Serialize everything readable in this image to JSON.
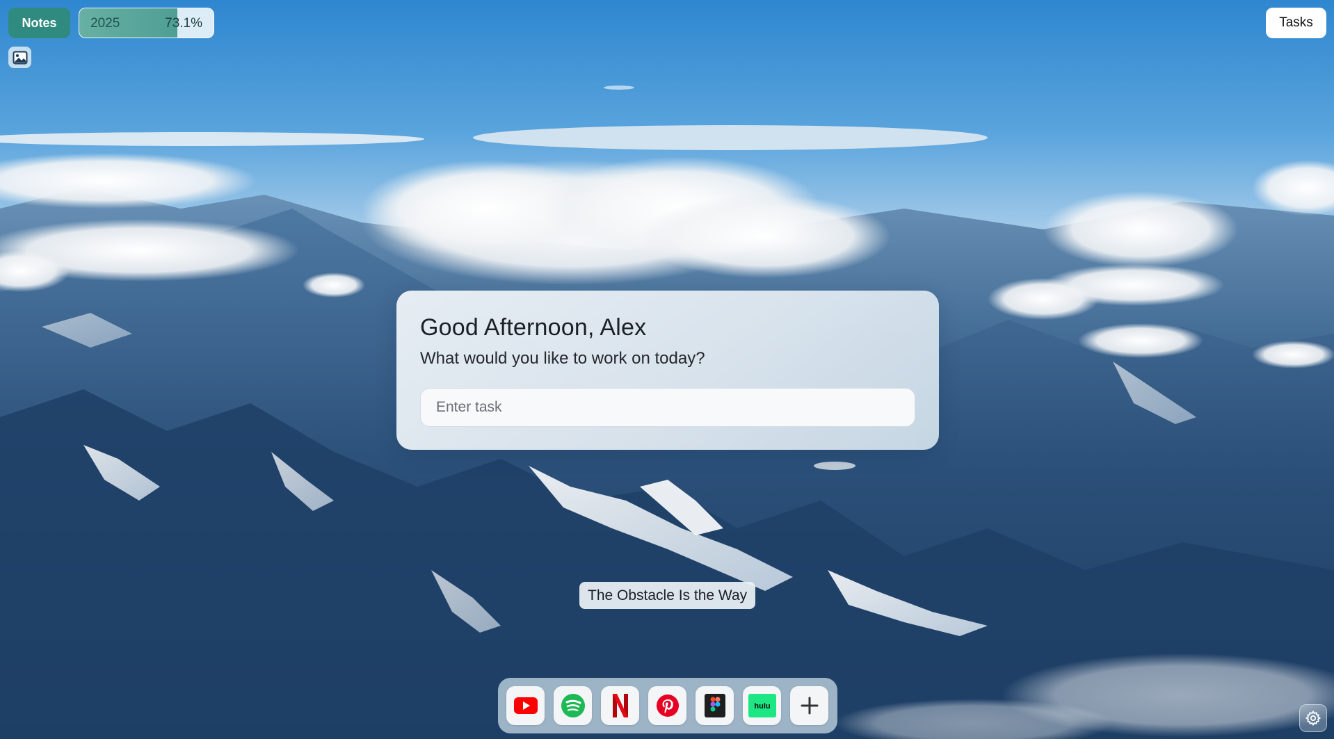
{
  "header": {
    "notes_label": "Notes",
    "year_label": "2025",
    "year_progress_text": "73.1%",
    "year_progress_fraction": 0.731,
    "tasks_label": "Tasks"
  },
  "card": {
    "greeting": "Good Afternoon, Alex",
    "subtitle": "What would you like to work on today?",
    "task_input_placeholder": "Enter task",
    "task_input_value": ""
  },
  "quote": "The Obstacle Is the Way",
  "dock": {
    "items": [
      {
        "icon": "youtube-icon",
        "color": "#ff0000"
      },
      {
        "icon": "spotify-icon",
        "color": "#1db954"
      },
      {
        "icon": "netflix-icon",
        "color": "#e50914"
      },
      {
        "icon": "pinterest-icon",
        "color": "#e60023"
      },
      {
        "icon": "figma-icon",
        "color": "#1e1e1e"
      },
      {
        "icon": "hulu-icon",
        "color": "#1ce783"
      },
      {
        "icon": "add-icon",
        "color": "#333333"
      }
    ]
  },
  "theme": {
    "accent": "#2f8a80",
    "card_bg": "#eef2f6"
  }
}
